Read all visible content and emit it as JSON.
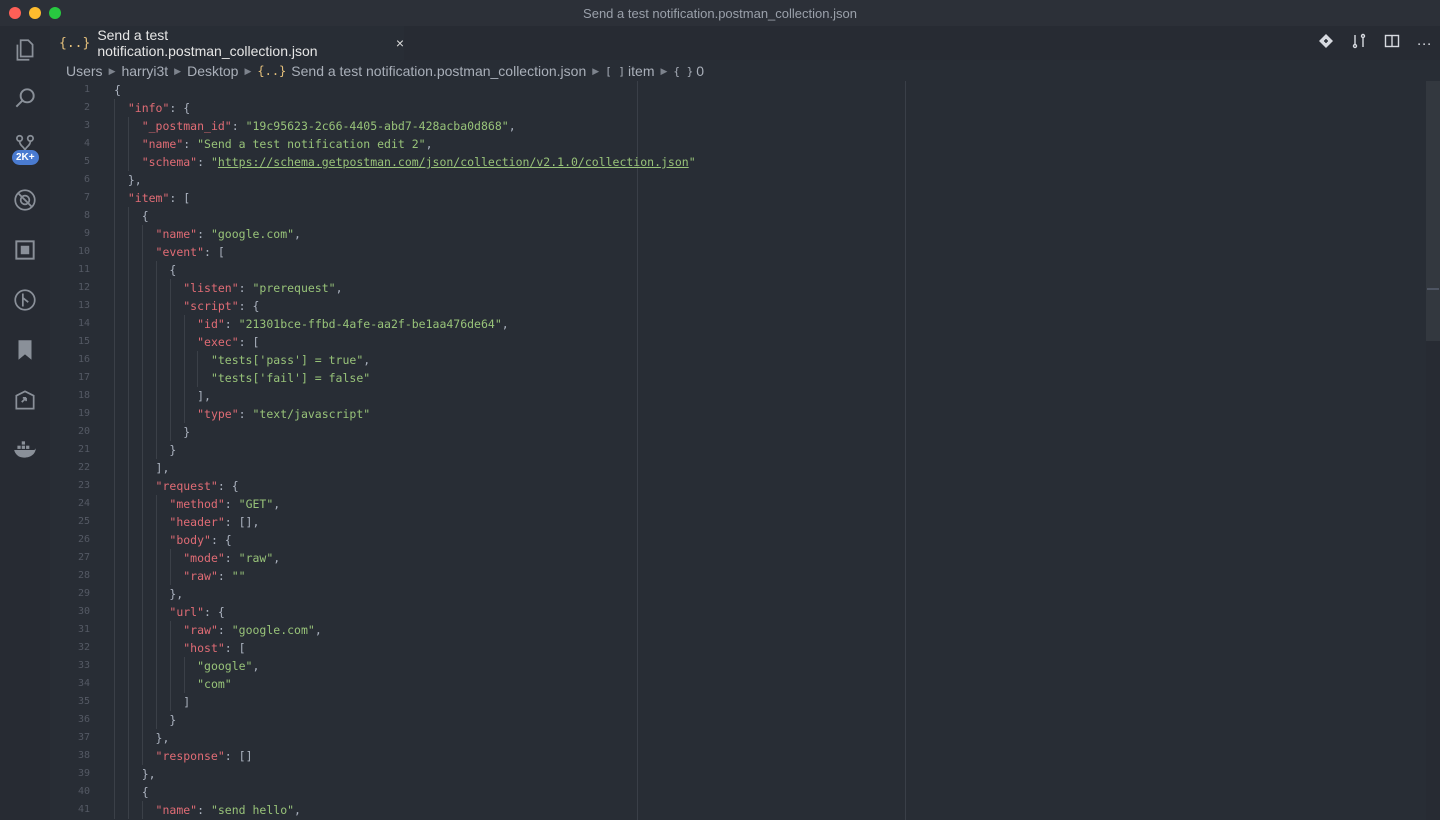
{
  "window": {
    "title": "Send a test notification.postman_collection.json"
  },
  "activity_bar": {
    "items": [
      {
        "name": "explorer",
        "icon": "files-icon"
      },
      {
        "name": "search",
        "icon": "search-icon"
      },
      {
        "name": "source-control",
        "icon": "source-control-icon",
        "badge": "2K+"
      },
      {
        "name": "debug",
        "icon": "debug-icon"
      },
      {
        "name": "extensions",
        "icon": "extensions-icon"
      },
      {
        "name": "git-lens",
        "icon": "git-history-icon"
      },
      {
        "name": "bookmarks",
        "icon": "bookmark-icon"
      },
      {
        "name": "remote",
        "icon": "remote-icon"
      },
      {
        "name": "docker",
        "icon": "docker-icon"
      }
    ]
  },
  "tab": {
    "icon": "{..}",
    "label": "Send a test notification.postman_collection.json",
    "close": "×"
  },
  "editor_actions": {
    "icons": [
      "compare-icon",
      "open-changes-icon",
      "split-editor-icon",
      "more-actions-icon"
    ],
    "more": "···"
  },
  "breadcrumb": {
    "parts": [
      "Users",
      "harryi3t",
      "Desktop",
      "Send a test notification.postman_collection.json",
      "item",
      "0"
    ],
    "json_icon": "{..}",
    "array_sym": "[ ]",
    "object_sym": "{ }"
  },
  "code": {
    "line_numbers": [
      "1",
      "2",
      "3",
      "4",
      "5",
      "6",
      "7",
      "8",
      "9",
      "10",
      "11",
      "12",
      "13",
      "14",
      "15",
      "16",
      "17",
      "18",
      "19",
      "20",
      "21",
      "22",
      "23",
      "24",
      "25",
      "26",
      "27",
      "28",
      "29",
      "30",
      "31",
      "32",
      "33",
      "34",
      "35",
      "36",
      "37",
      "38",
      "39",
      "40",
      "41"
    ],
    "lines": [
      "{",
      "  \"info\": {",
      "    \"_postman_id\": \"19c95623-2c66-4405-abd7-428acba0d868\",",
      "    \"name\": \"Send a test notification edit 2\",",
      "    \"schema\": \"https://schema.getpostman.com/json/collection/v2.1.0/collection.json\"",
      "  },",
      "  \"item\": [",
      "    {",
      "      \"name\": \"google.com\",",
      "      \"event\": [",
      "        {",
      "          \"listen\": \"prerequest\",",
      "          \"script\": {",
      "            \"id\": \"21301bce-ffbd-4afe-aa2f-be1aa476de64\",",
      "            \"exec\": [",
      "              \"tests['pass'] = true\",",
      "              \"tests['fail'] = false\"",
      "            ],",
      "            \"type\": \"text/javascript\"",
      "          }",
      "        }",
      "      ],",
      "      \"request\": {",
      "        \"method\": \"GET\",",
      "        \"header\": [],",
      "        \"body\": {",
      "          \"mode\": \"raw\",",
      "          \"raw\": \"\"",
      "        },",
      "        \"url\": {",
      "          \"raw\": \"google.com\",",
      "          \"host\": [",
      "            \"google\",",
      "            \"com\"",
      "          ]",
      "        }",
      "      },",
      "      \"response\": []",
      "    },",
      "    {",
      "      \"name\": \"send hello\","
    ]
  },
  "colors": {
    "key": "#e06c75",
    "string": "#98c379",
    "punctuation": "#abb2bf",
    "background": "#282d35"
  }
}
